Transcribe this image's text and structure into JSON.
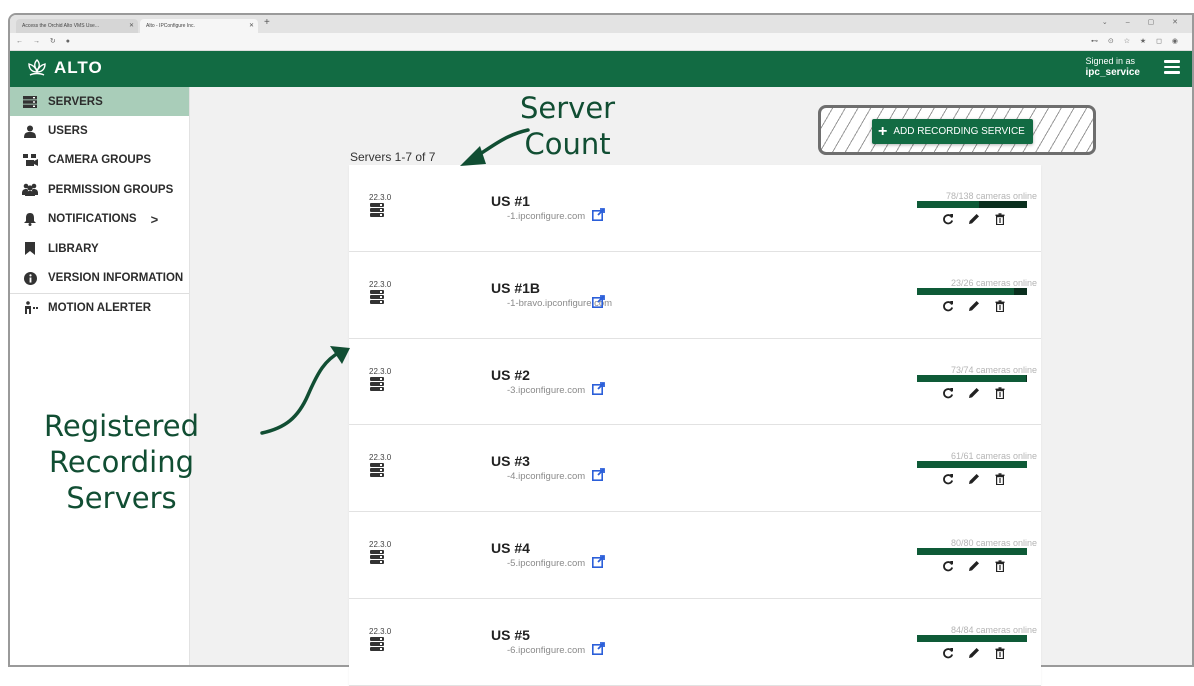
{
  "browser": {
    "tabs": [
      {
        "title": "Access the Orchid Alto VMS Use..."
      },
      {
        "title": "Alto - IPConfigure Inc."
      }
    ]
  },
  "app": {
    "logo_text": "ALTO",
    "signed_in_label": "Signed in as",
    "username": "ipc_service"
  },
  "sidebar": {
    "items": [
      {
        "label": "SERVERS",
        "icon": "server-icon"
      },
      {
        "label": "USERS",
        "icon": "user-icon"
      },
      {
        "label": "CAMERA GROUPS",
        "icon": "camera-group-icon"
      },
      {
        "label": "PERMISSION GROUPS",
        "icon": "people-icon"
      },
      {
        "label": "NOTIFICATIONS",
        "icon": "bell-icon"
      },
      {
        "label": "LIBRARY",
        "icon": "bookmark-icon"
      },
      {
        "label": "VERSION INFORMATION",
        "icon": "info-icon"
      },
      {
        "label": "MOTION ALERTER",
        "icon": "motion-icon"
      }
    ]
  },
  "main": {
    "server_count": "Servers 1-7 of 7",
    "add_button": "ADD RECORDING SERVICE",
    "servers": [
      {
        "version": "22.3.0",
        "name": "US #1",
        "host": "-1.ipconfigure.com",
        "cameras": "78/138 cameras online",
        "online": 78,
        "total": 138
      },
      {
        "version": "22.3.0",
        "name": "US #1B",
        "host": "-1-bravo.ipconfigure.com",
        "cameras": "23/26 cameras online",
        "online": 23,
        "total": 26
      },
      {
        "version": "22.3.0",
        "name": "US #2",
        "host": "-3.ipconfigure.com",
        "cameras": "73/74 cameras online",
        "online": 73,
        "total": 74
      },
      {
        "version": "22.3.0",
        "name": "US #3",
        "host": "-4.ipconfigure.com",
        "cameras": "61/61 cameras online",
        "online": 61,
        "total": 61
      },
      {
        "version": "22.3.0",
        "name": "US #4",
        "host": "-5.ipconfigure.com",
        "cameras": "80/80 cameras online",
        "online": 80,
        "total": 80
      },
      {
        "version": "22.3.0",
        "name": "US #5",
        "host": "-6.ipconfigure.com",
        "cameras": "84/84 cameras online",
        "online": 84,
        "total": 84
      }
    ]
  },
  "annotations": {
    "server_count_1": "Server",
    "server_count_2": "Count",
    "registered_1": "Registered",
    "registered_2": "Recording",
    "registered_3": "Servers"
  },
  "colors": {
    "brand_green": "#126b43",
    "active_nav": "#a9cdb9",
    "annotation": "#114e33"
  }
}
